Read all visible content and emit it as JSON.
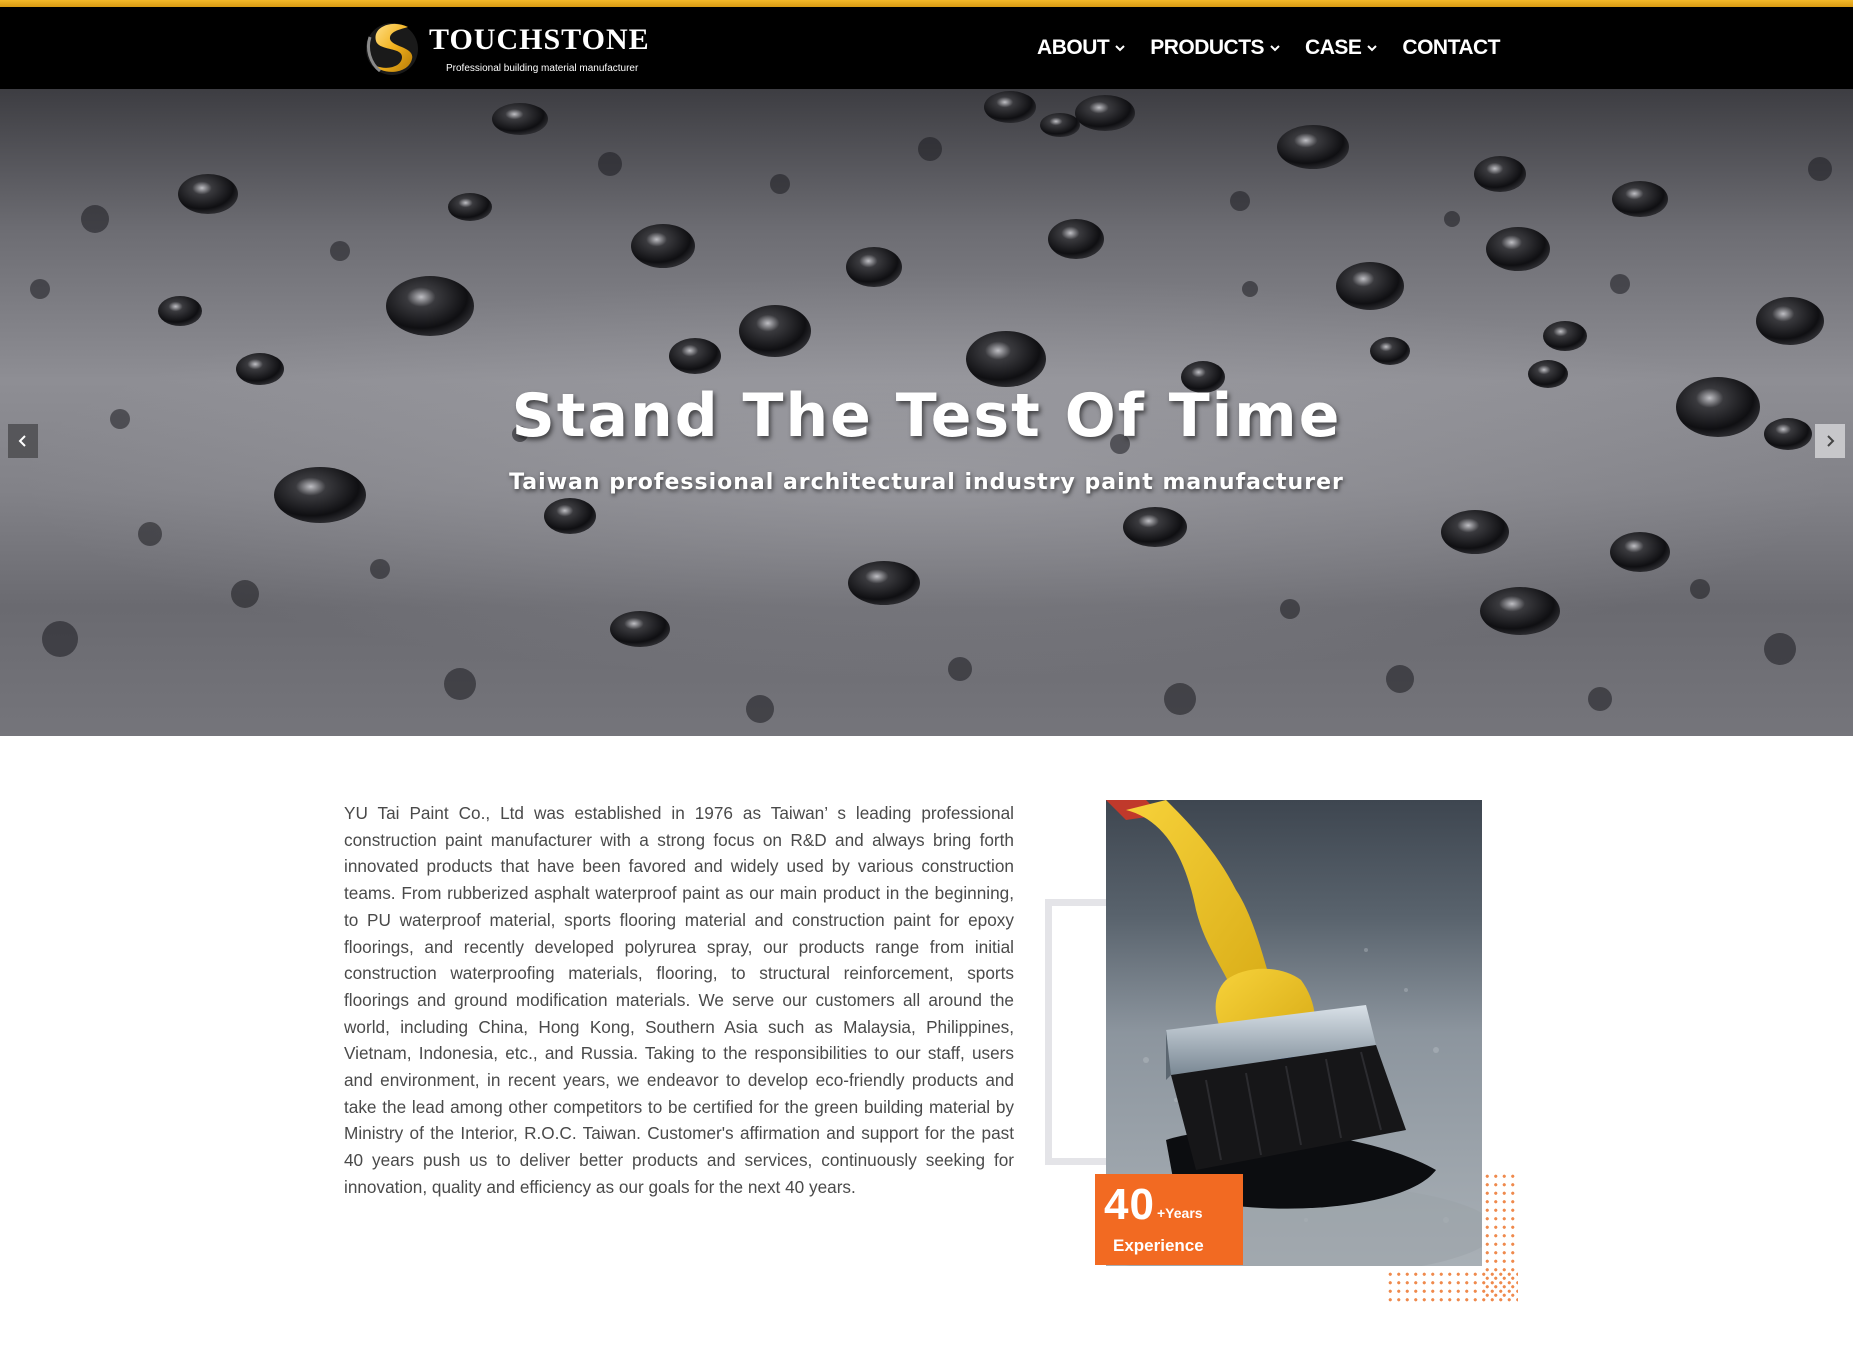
{
  "header": {
    "brand_name": "TOUCHSTONE",
    "brand_tagline": "Professional building material manufacturer",
    "nav": [
      {
        "label": "ABOUT",
        "has_dropdown": true
      },
      {
        "label": "PRODUCTS",
        "has_dropdown": true
      },
      {
        "label": "CASE",
        "has_dropdown": true
      },
      {
        "label": "CONTACT",
        "has_dropdown": false
      }
    ],
    "icons": [
      "logo-icon",
      "chevron-down-icon"
    ]
  },
  "hero": {
    "title": "Stand The Test Of Time",
    "subtitle": "Taiwan professional architectural industry paint manufacturer",
    "controls": [
      "chevron-left-icon",
      "chevron-right-icon"
    ]
  },
  "about": {
    "paragraph": "YU Tai Paint Co., Ltd was established in 1976 as Taiwan’ s leading professional construction paint manufacturer with a strong focus on R&D and always bring forth innovated products that have been favored and widely used by various construction teams. From rubberized asphalt waterproof paint as our main product in the beginning, to PU waterproof material, sports flooring material and construction paint for epoxy floorings, and recently developed polyrurea spray, our products range from initial construction waterproofing materials, flooring, to structural reinforcement, sports floorings and ground modification materials. We serve our customers all around the world, including China, Hong Kong, Southern Asia such as Malaysia, Philippines, Vietnam, Indonesia, etc., and Russia. Taking to the responsibilities to our staff, users and environment, in recent years, we endeavor to develop eco-friendly products and take the lead among other competitors to be certified for the green building material by Ministry of the Interior, R.O.C. Taiwan. Customer's affirmation and support for the past 40 years push us to deliver better products and services, continuously seeking for innovation, quality and efficiency as our goals for the next 40 years.",
    "badge": {
      "number": "40",
      "unit": "+Years",
      "label": "Experience"
    }
  },
  "colors": {
    "accent_gold": "#f3b829",
    "badge_orange": "#f26a22",
    "dots_orange": "#ef8a4d",
    "header_bg": "#000000"
  }
}
